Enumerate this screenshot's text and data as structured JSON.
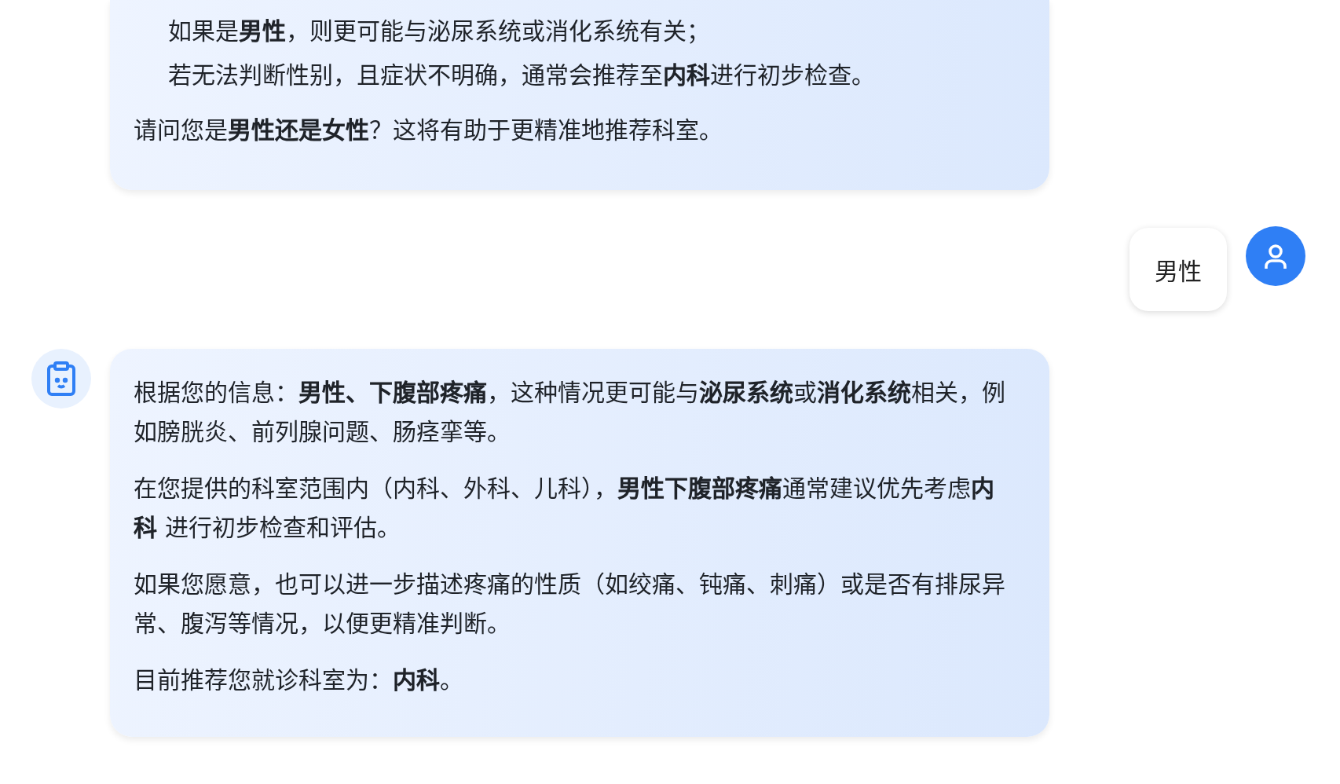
{
  "messages": [
    {
      "kind": "assistant_continued",
      "blocks": [
        {
          "kind": "list",
          "items": [
            "如果是**男性**，则更可能与泌尿系统或消化系统有关；",
            "若无法判断性别，且症状不明确，通常会推荐至**内科**进行初步检查。"
          ]
        },
        {
          "kind": "paragraph",
          "text": "请问您是**男性还是女性**？这将有助于更精准地推荐科室。"
        }
      ]
    },
    {
      "kind": "user",
      "text": "男性"
    },
    {
      "kind": "assistant",
      "blocks": [
        {
          "kind": "paragraph",
          "text": "根据您的信息：**男性、下腹部疼痛**，这种情况更可能与**泌尿系统**或**消化系统**相关，例如膀胱炎、前列腺问题、肠痉挛等。"
        },
        {
          "kind": "paragraph",
          "text": "在您提供的科室范围内（内科、外科、儿科），**男性下腹部疼痛**通常建议优先考虑**内科** 进行初步检查和评估。"
        },
        {
          "kind": "paragraph",
          "text": "如果您愿意，也可以进一步描述疼痛的性质（如绞痛、钝痛、刺痛）或是否有排尿异常、腹泻等情况，以便更精准判断。"
        },
        {
          "kind": "paragraph",
          "text": "目前推荐您就诊科室为：**内科**。"
        }
      ]
    }
  ]
}
